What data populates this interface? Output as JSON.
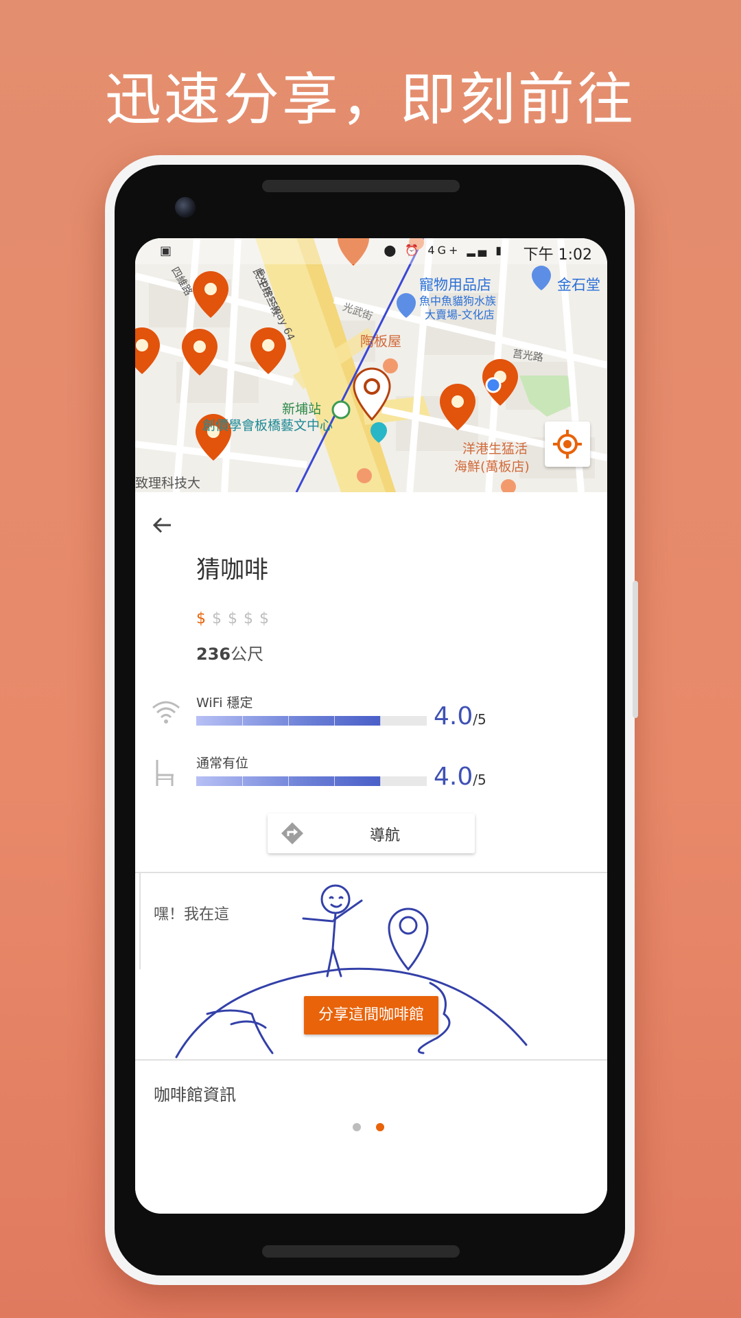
{
  "headline": "迅速分享，即刻前往",
  "status_bar": {
    "time": "下午 1:02",
    "network": "4G+"
  },
  "map": {
    "labels": {
      "pet_shop": "寵物用品店",
      "pet_shop_sub1": "魚中魚貓狗水族",
      "pet_shop_sub2": "大賣場-文化店",
      "golden_stone": "金石堂",
      "taoban": "陶板屋",
      "guangwu": "光武街",
      "expressway": "Expressway 64",
      "minsheng": "民生路三段",
      "juguang": "莒光路",
      "xinpu": "新埔站",
      "center": "創價學會板橋藝文中心",
      "seafood1": "洋港生猛活",
      "seafood2": "海鮮(萬板店)",
      "tech": "致理科技大",
      "sihui": "四維路"
    }
  },
  "cafe": {
    "name": "猜咖啡",
    "price_symbols": [
      "$",
      "$",
      "$",
      "$",
      "$"
    ],
    "price_level": 1,
    "distance_value": "236",
    "distance_unit": "公尺"
  },
  "ratings": [
    {
      "label": "WiFi 穩定",
      "score": "4.0",
      "max": "/5",
      "fraction": 0.8,
      "icon": "wifi-icon"
    },
    {
      "label": "通常有位",
      "score": "4.0",
      "max": "/5",
      "fraction": 0.8,
      "icon": "chair-icon"
    }
  ],
  "navigate_label": "導航",
  "share": {
    "text": "嘿！我在這",
    "button_label": "分享這間咖啡館"
  },
  "info_title": "咖啡館資訊",
  "colors": {
    "accent": "#e8630a",
    "rating": "#3f51b5",
    "background": "#e38e6f"
  }
}
